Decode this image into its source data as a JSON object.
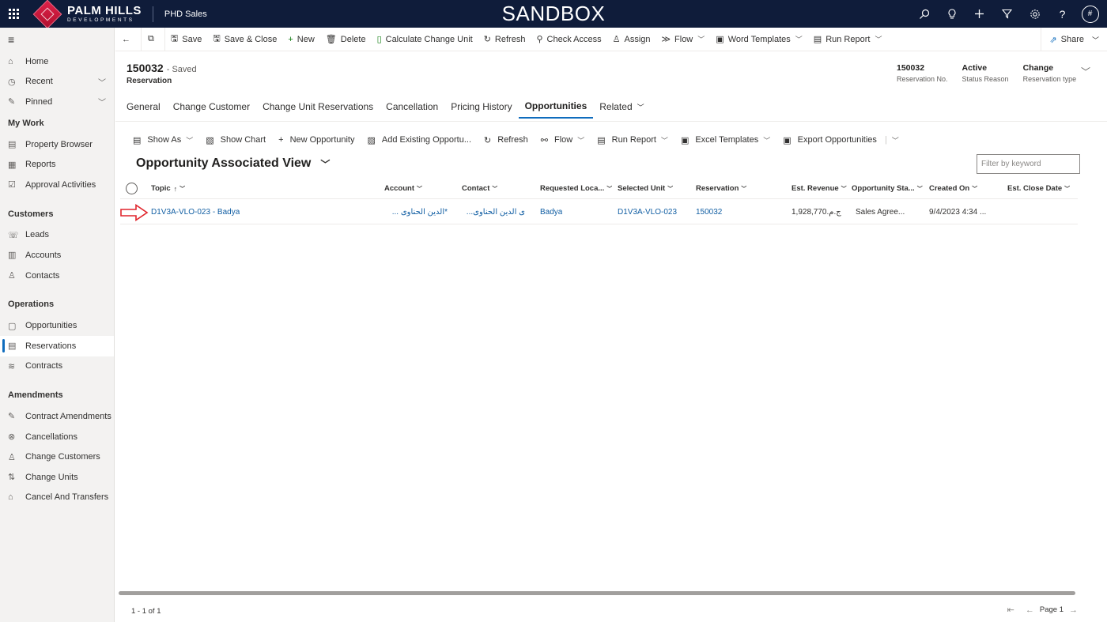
{
  "topbar": {
    "logo_main": "PALM HILLS",
    "logo_sub": "DEVELOPMENTS",
    "app_name": "PHD Sales",
    "environment": "SANDBOX",
    "user_initial": "#"
  },
  "sidebar": {
    "items_top": [
      {
        "label": "Home",
        "icon": "home-icon"
      },
      {
        "label": "Recent",
        "icon": "clock-icon",
        "chevron": true
      },
      {
        "label": "Pinned",
        "icon": "pin-icon",
        "chevron": true
      }
    ],
    "groups": [
      {
        "title": "My Work",
        "items": [
          "Property Browser",
          "Reports",
          "Approval Activities"
        ]
      },
      {
        "title": "Customers",
        "items": [
          "Leads",
          "Accounts",
          "Contacts"
        ]
      },
      {
        "title": "Operations",
        "items": [
          "Opportunities",
          "Reservations",
          "Contracts"
        ]
      },
      {
        "title": "Amendments",
        "items": [
          "Contract Amendments",
          "Cancellations",
          "Change Customers",
          "Change Units",
          "Cancel And Transfers"
        ]
      }
    ],
    "active_item": "Reservations"
  },
  "cmdbar": {
    "save": "Save",
    "save_close": "Save & Close",
    "new": "New",
    "delete": "Delete",
    "calc_change_unit": "Calculate Change Unit",
    "refresh": "Refresh",
    "check_access": "Check Access",
    "assign": "Assign",
    "flow": "Flow",
    "word_templates": "Word Templates",
    "run_report": "Run Report",
    "share": "Share"
  },
  "record": {
    "title": "150032",
    "saved_status": "- Saved",
    "entity": "Reservation",
    "header_fields": [
      {
        "value": "150032",
        "label": "Reservation No."
      },
      {
        "value": "Active",
        "label": "Status Reason"
      },
      {
        "value": "Change",
        "label": "Reservation type"
      }
    ]
  },
  "tabs": [
    "General",
    "Change Customer",
    "Change Unit Reservations",
    "Cancellation",
    "Pricing History",
    "Opportunities",
    "Related"
  ],
  "active_tab": "Opportunities",
  "subgrid": {
    "cmd": {
      "show_as": "Show As",
      "show_chart": "Show Chart",
      "new_opportunity": "New Opportunity",
      "add_existing": "Add Existing Opportu...",
      "refresh": "Refresh",
      "flow": "Flow",
      "run_report": "Run Report",
      "excel_templates": "Excel Templates",
      "export": "Export Opportunities"
    },
    "view_title": "Opportunity Associated View",
    "filter_placeholder": "Filter by keyword",
    "columns": [
      "Topic",
      "Account",
      "Contact",
      "Requested Loca...",
      "Selected Unit",
      "Reservation",
      "Est. Revenue",
      "Opportunity Sta...",
      "Created On",
      "Est. Close Date"
    ],
    "rows": [
      {
        "topic": "D1V3A-VLO-023 - Badya",
        "account": "*الدين الحناوى ...",
        "contact": "ى الدين الحناوى...",
        "requested_location": "Badya",
        "selected_unit": "D1V3A-VLO-023",
        "reservation": "150032",
        "est_revenue": "1,928,770.ج.م",
        "status": "Sales Agree...",
        "created_on": "9/4/2023 4:34 ...",
        "close_date": ""
      }
    ],
    "record_count": "1 - 1 of 1",
    "page_label": "Page 1"
  }
}
